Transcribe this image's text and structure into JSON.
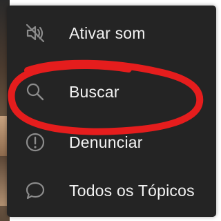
{
  "menu": {
    "items": [
      {
        "label": "Ativar som",
        "icon": "speaker-muted-icon"
      },
      {
        "label": "Buscar",
        "icon": "search-icon"
      },
      {
        "label": "Denunciar",
        "icon": "report-exclamation-icon"
      },
      {
        "label": "Todos os Tópicos",
        "icon": "chat-bubble-icon"
      }
    ]
  },
  "colors": {
    "menu_background": "#242424",
    "menu_text": "#f2f2f2",
    "icon_stroke": "#8c8c8c",
    "annotation_stroke": "#e51d1d"
  }
}
